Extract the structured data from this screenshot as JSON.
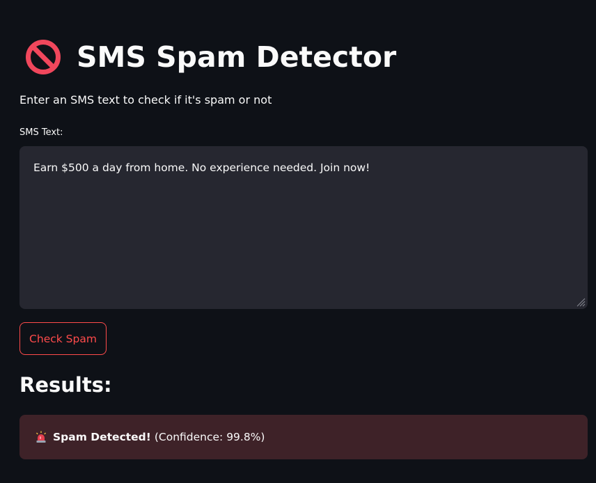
{
  "header": {
    "icon": "no-entry-icon",
    "title": "SMS Spam Detector",
    "subtitle": "Enter an SMS text to check if it's spam or not"
  },
  "form": {
    "label": "SMS Text:",
    "value": "Earn $500 a day from home. No experience needed. Join now!",
    "button_label": "Check Spam"
  },
  "results": {
    "heading": "Results:",
    "alert_icon": "siren-icon",
    "alert_strong": "Spam Detected!",
    "alert_detail": "(Confidence: 99.8%)"
  },
  "colors": {
    "background": "#0e1117",
    "input_background": "#262730",
    "accent": "#ff4b4b",
    "error_background": "#3e2228"
  }
}
